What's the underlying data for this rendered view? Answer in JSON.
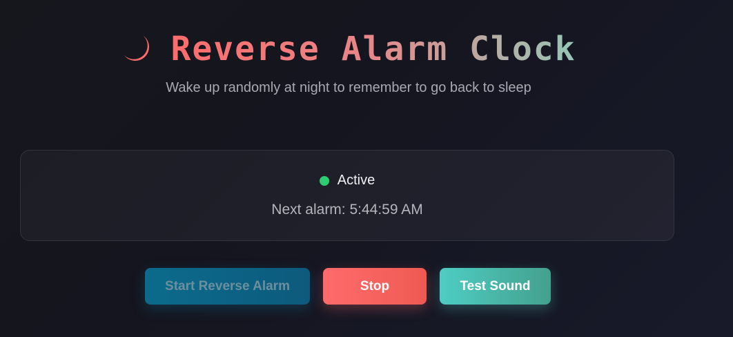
{
  "header": {
    "icon": "crescent-moon-icon",
    "title": "Reverse Alarm Clock",
    "subtitle": "Wake up randomly at night to remember to go back to sleep"
  },
  "status": {
    "state": "Active",
    "next_alarm": "Next alarm: 5:44:59 AM",
    "dot_color": "#2ecc71"
  },
  "buttons": {
    "start_label": "Start Reverse Alarm",
    "start_disabled": true,
    "stop_label": "Stop",
    "test_label": "Test Sound"
  },
  "colors": {
    "accent_red": "#ff6b6b",
    "accent_teal": "#4ecdc4",
    "accent_blue": "#0b6b8c"
  }
}
